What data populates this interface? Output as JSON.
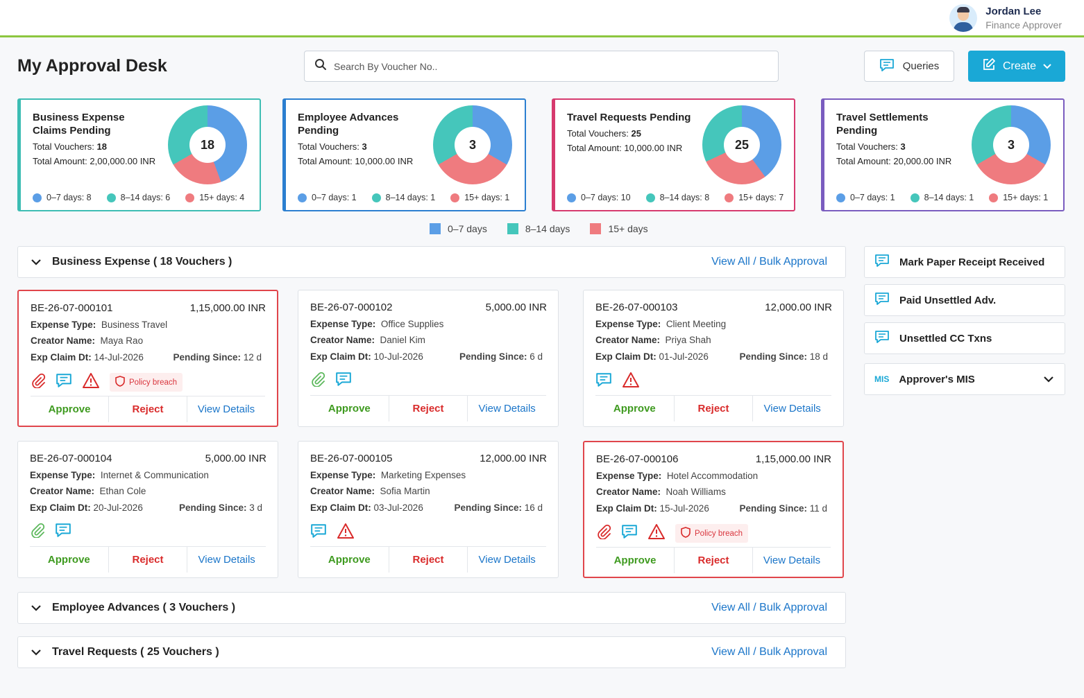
{
  "header": {
    "user_name": "Jordan Lee",
    "user_role": "Finance Approver"
  },
  "page_title": "My Approval Desk",
  "search": {
    "placeholder": "Search By Voucher No.."
  },
  "buttons": {
    "queries": "Queries",
    "create": "Create"
  },
  "summary_cards": [
    {
      "title": "Business Expense Claims Pending",
      "total_vouchers_label": "Total Vouchers:",
      "total_vouchers": "18",
      "total_amount_label": "Total Amount:",
      "total_amount": "2,00,000.00 INR",
      "center": "18",
      "l1": "0–7 days: 8",
      "l2": "8–14 days: 6",
      "l3": "15+ days: 4",
      "color": "#3dbdb3",
      "counts": [
        8,
        6,
        4
      ]
    },
    {
      "title": "Employee Advances Pending",
      "total_vouchers_label": "Total Vouchers:",
      "total_vouchers": "3",
      "total_amount_label": "Total Amount:",
      "total_amount": "10,000.00 INR",
      "center": "3",
      "l1": "0–7 days: 1",
      "l2": "8–14 days: 1",
      "l3": "15+ days: 1",
      "color": "#2b7fd0",
      "counts": [
        1,
        1,
        1
      ]
    },
    {
      "title": "Travel Requests Pending",
      "total_vouchers_label": "Total Vouchers:",
      "total_vouchers": "25",
      "total_amount_label": "Total Amount:",
      "total_amount": "10,000.00 INR",
      "center": "25",
      "l1": "0–7 days: 10",
      "l2": "8–14 days: 8",
      "l3": "15+ days: 7",
      "color": "#d63a6e",
      "counts": [
        10,
        8,
        7
      ]
    },
    {
      "title": "Travel Settlements Pending",
      "total_vouchers_label": "Total Vouchers:",
      "total_vouchers": "3",
      "total_amount_label": "Total Amount:",
      "total_amount": "20,000.00 INR",
      "center": "3",
      "l1": "0–7 days: 1",
      "l2": "8–14 days: 1",
      "l3": "15+ days: 1",
      "color": "#7a5cbf",
      "counts": [
        1,
        1,
        1
      ]
    }
  ],
  "legend": {
    "a": "0–7 days",
    "b": "8–14 days",
    "c": "15+ days"
  },
  "colors": {
    "age_0_7": "#5b9ee6",
    "age_8_14": "#45c6bb",
    "age_15": "#ef7b7f",
    "accent": "#1aa8d6",
    "approve": "#3e9a1f",
    "reject": "#d92b2b",
    "link": "#1a75c9"
  },
  "sections": {
    "business": {
      "label": "Business Expense ( 18 Vouchers )",
      "link": "View All / Bulk Approval"
    },
    "advances": {
      "label": "Employee Advances ( 3 Vouchers )",
      "link": "View All / Bulk Approval"
    },
    "travel": {
      "label": "Travel Requests ( 25 Vouchers )",
      "link": "View All / Bulk Approval"
    }
  },
  "field_labels": {
    "expense_type": "Expense Type:",
    "creator": "Creator Name:",
    "claim_dt": "Exp Claim Dt:",
    "pending": "Pending Since:"
  },
  "actions": {
    "approve": "Approve",
    "reject": "Reject",
    "view": "View Details"
  },
  "vouchers": [
    {
      "no": "BE-26-07-000101",
      "amount": "1,15,000.00 INR",
      "type": "Business Travel",
      "creator": "Maya Rao",
      "date": "14-Jul-2026",
      "pending": "12 d",
      "badge": "Policy breach"
    },
    {
      "no": "BE-26-07-000102",
      "amount": "5,000.00 INR",
      "type": "Office Supplies",
      "creator": "Daniel Kim",
      "date": "10-Jul-2026",
      "pending": "6 d"
    },
    {
      "no": "BE-26-07-000103",
      "amount": "12,000.00 INR",
      "type": "Client Meeting",
      "creator": "Priya Shah",
      "date": "01-Jul-2026",
      "pending": "18 d"
    },
    {
      "no": "BE-26-07-000104",
      "amount": "5,000.00 INR",
      "type": "Internet & Communication",
      "creator": "Ethan Cole",
      "date": "20-Jul-2026",
      "pending": "3 d"
    },
    {
      "no": "BE-26-07-000105",
      "amount": "12,000.00 INR",
      "type": "Marketing Expenses",
      "creator": "Sofia Martin",
      "date": "03-Jul-2026",
      "pending": "16 d"
    },
    {
      "no": "BE-26-07-000106",
      "amount": "1,15,000.00 INR",
      "type": "Hotel Accommodation",
      "creator": "Noah Williams",
      "date": "15-Jul-2026",
      "pending": "11 d",
      "badge": "Policy breach"
    }
  ],
  "sidebar": {
    "receipt": "Mark Paper Receipt Received",
    "paid": "Paid Unsettled Adv.",
    "cc": "Unsettled CC Txns",
    "mis_tag": "MIS",
    "mis": "Approver's MIS"
  }
}
